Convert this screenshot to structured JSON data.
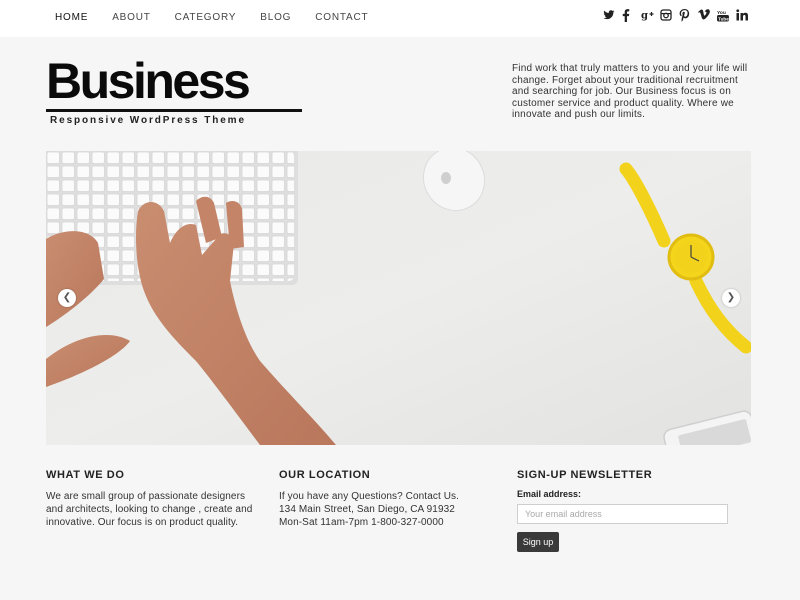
{
  "nav": {
    "items": [
      "HOME",
      "ABOUT",
      "CATEGORY",
      "BLOG",
      "CONTACT"
    ],
    "active_index": 0
  },
  "social": {
    "icons": [
      "twitter-icon",
      "facebook-icon",
      "google-plus-icon",
      "instagram-icon",
      "pinterest-icon",
      "vimeo-icon",
      "youtube-icon",
      "linkedin-icon"
    ]
  },
  "logo": {
    "word": "Business",
    "tagline": "Responsive WordPress Theme"
  },
  "intro": {
    "text": "Find work that truly matters to you and your life will change. Forget about your traditional recruitment and searching for job. Our Business focus is on customer service and product quality. Where we innovate and push our limits."
  },
  "slider": {
    "prev_icon": "chevron-left-icon",
    "next_icon": "chevron-right-icon"
  },
  "footer": {
    "what_we_do": {
      "title": "WHAT WE DO",
      "text": "We are small group of passionate designers and architects, looking to change , create and innovative. Our focus is on product quality."
    },
    "location": {
      "title": "OUR LOCATION",
      "line1": "If you have any Questions? Contact Us.",
      "line2": "134 Main Street, San Diego, CA 91932",
      "line3": "Mon-Sat 11am-7pm 1-800-327-0000"
    },
    "newsletter": {
      "title": "SIGN-UP NEWSLETTER",
      "email_label": "Email address:",
      "email_placeholder": "Your email address",
      "email_value": "",
      "button_label": "Sign up"
    }
  },
  "colors": {
    "page_bg": "#f6f6f6",
    "topbar_bg": "#ffffff",
    "button_bg": "#3a3a3a",
    "watch_yellow": "#f2d21a"
  }
}
